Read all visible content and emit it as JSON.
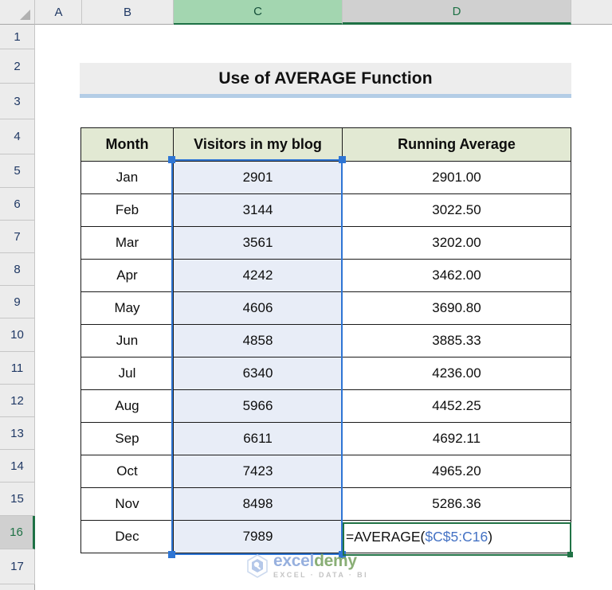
{
  "app": "excel-worksheet",
  "column_headers": [
    {
      "label": "A",
      "state": "normal"
    },
    {
      "label": "B",
      "state": "normal"
    },
    {
      "label": "C",
      "state": "selected"
    },
    {
      "label": "D",
      "state": "active"
    }
  ],
  "row_headers": [
    {
      "label": "1",
      "state": "normal"
    },
    {
      "label": "2",
      "state": "normal"
    },
    {
      "label": "3",
      "state": "normal"
    },
    {
      "label": "4",
      "state": "normal"
    },
    {
      "label": "5",
      "state": "normal"
    },
    {
      "label": "6",
      "state": "normal"
    },
    {
      "label": "7",
      "state": "normal"
    },
    {
      "label": "8",
      "state": "normal"
    },
    {
      "label": "9",
      "state": "normal"
    },
    {
      "label": "10",
      "state": "normal"
    },
    {
      "label": "11",
      "state": "normal"
    },
    {
      "label": "12",
      "state": "normal"
    },
    {
      "label": "13",
      "state": "normal"
    },
    {
      "label": "14",
      "state": "normal"
    },
    {
      "label": "15",
      "state": "normal"
    },
    {
      "label": "16",
      "state": "active"
    },
    {
      "label": "17",
      "state": "normal"
    }
  ],
  "title": {
    "text": "Use of AVERAGE Function",
    "background": "#EDEDED",
    "underline_color": "#B4CDE6"
  },
  "table": {
    "header_background": "#E2E9D3",
    "headers": [
      "Month",
      "Visitors in my blog",
      "Running Average"
    ],
    "rows": [
      {
        "month": "Jan",
        "visitors": "2901",
        "average": "2901.00"
      },
      {
        "month": "Feb",
        "visitors": "3144",
        "average": "3022.50"
      },
      {
        "month": "Mar",
        "visitors": "3561",
        "average": "3202.00"
      },
      {
        "month": "Apr",
        "visitors": "4242",
        "average": "3462.00"
      },
      {
        "month": "May",
        "visitors": "4606",
        "average": "3690.80"
      },
      {
        "month": "Jun",
        "visitors": "4858",
        "average": "3885.33"
      },
      {
        "month": "Jul",
        "visitors": "6340",
        "average": "4236.00"
      },
      {
        "month": "Aug",
        "visitors": "5966",
        "average": "4452.25"
      },
      {
        "month": "Sep",
        "visitors": "6611",
        "average": "4692.11"
      },
      {
        "month": "Oct",
        "visitors": "7423",
        "average": "4965.20"
      },
      {
        "month": "Nov",
        "visitors": "8498",
        "average": "5286.36"
      },
      {
        "month": "Dec",
        "visitors": "7989",
        "average": ""
      }
    ]
  },
  "formula_cell": {
    "prefix": "=AVERAGE(",
    "range": "$C$5:C16",
    "suffix": ")",
    "prefix_color": "#111111",
    "range_color": "#4472C4",
    "border_color": "#217346"
  },
  "selection": {
    "range_border_color": "#2E75D4",
    "range_fill_color": "#E8EDF7",
    "active_cell_border_color": "#217346"
  },
  "watermark": {
    "name_part1": "excel",
    "name_part2": "demy",
    "tagline": "EXCEL  ·  DATA  ·  BI",
    "color1": "#8FAADC",
    "color2": "#7FA86A"
  }
}
